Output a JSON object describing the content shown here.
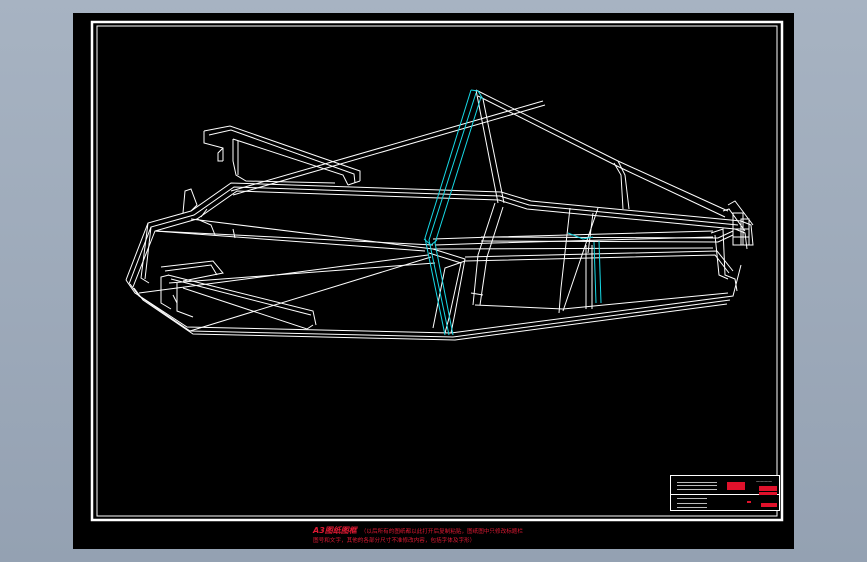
{
  "drawing": {
    "title_block": {
      "name_text": "————",
      "scale_text": ""
    },
    "note": {
      "title": "A3图纸图框",
      "line1": "（以后所有的图纸都以此打开后复制粘贴，图纸图中只修改标题栏",
      "line2": "图号和文字，其他的各部分尺寸不准修改内容，包括字体及字形）"
    },
    "colors": {
      "outline": "#ffffff",
      "accent": "#17d9e6",
      "note": "#e21a34"
    }
  }
}
